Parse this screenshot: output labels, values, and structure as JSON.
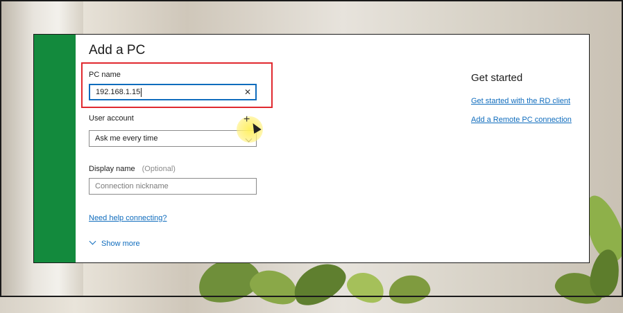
{
  "dialog": {
    "title": "Add a PC",
    "pc_name": {
      "label": "PC name",
      "value": "192.168.1.15",
      "clear_icon": "close-icon"
    },
    "user_account": {
      "label": "User account",
      "selected": "Ask me every time"
    },
    "display_name": {
      "label": "Display name",
      "optional": "(Optional)",
      "placeholder": "Connection nickname"
    },
    "help_link": "Need help connecting?",
    "show_more": "Show more"
  },
  "side_panel": {
    "title": "Get started",
    "links": [
      "Get started with the RD client",
      "Add a Remote PC connection"
    ]
  },
  "colors": {
    "accent": "#138a3d",
    "link": "#0f6cbd",
    "highlight": "#e0282e"
  }
}
